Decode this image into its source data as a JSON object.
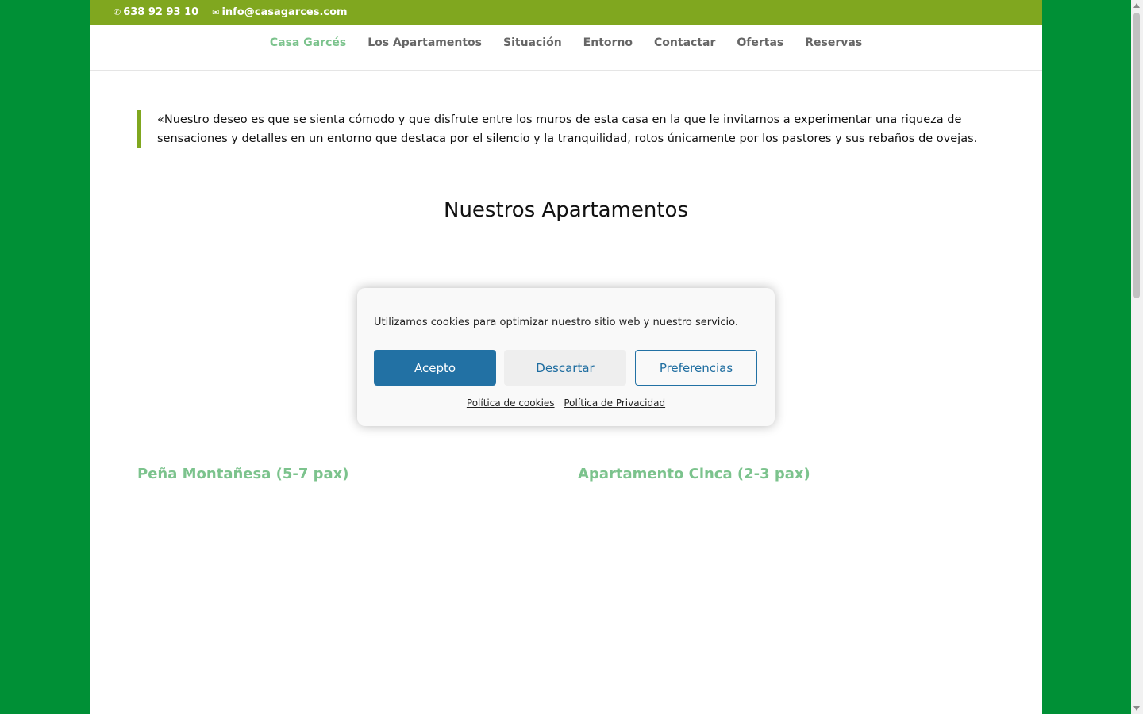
{
  "topbar": {
    "phone": "638 92 93 10",
    "email": "info@casagarces.com",
    "phone_icon": "phone-icon",
    "email_icon": "envelope-icon",
    "color": "#80a71f"
  },
  "nav": {
    "items": [
      {
        "label": "Casa Garcés",
        "active": true
      },
      {
        "label": "Los Apartamentos"
      },
      {
        "label": "Situación"
      },
      {
        "label": "Entorno"
      },
      {
        "label": "Contactar"
      },
      {
        "label": "Ofertas"
      },
      {
        "label": "Reservas"
      }
    ],
    "active_color": "#7cc38d"
  },
  "main": {
    "quote": "«Nuestro deseo es que se sienta cómodo y que disfrute entre los muros de esta casa en la que le invitamos a experimentar una riqueza de sensaciones y detalles en un entorno que destaca por el silencio y la tranquilidad, rotos únicamente por los pastores y sus rebaños de ovejas.",
    "section_title": "Nuestros Apartamentos",
    "apartments": [
      {
        "title": "Peña Montañesa (5-7 pax)"
      },
      {
        "title": "Apartamento Cinca (2-3 pax)"
      }
    ]
  },
  "cookie_banner": {
    "message": "Utilizamos cookies para optimizar nuestro sitio web y nuestro servicio.",
    "accept_label": "Acepto",
    "dismiss_label": "Descartar",
    "preferences_label": "Preferencias",
    "cookie_policy_link": "Política de cookies",
    "privacy_policy_link": "Política de Privacidad",
    "accent_color": "#2271a4"
  },
  "background_color": "#009036"
}
